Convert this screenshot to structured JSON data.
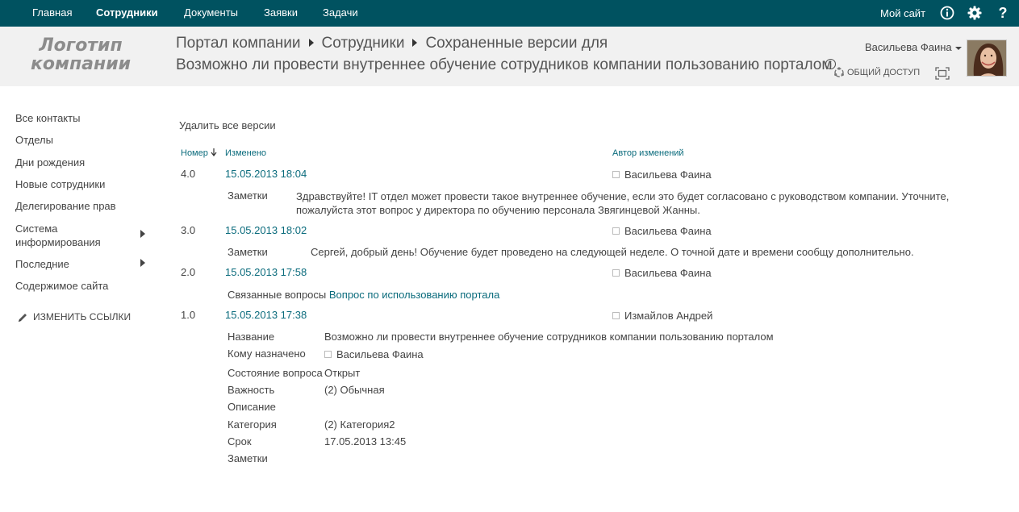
{
  "topnav": {
    "items": [
      "Главная",
      "Сотрудники",
      "Документы",
      "Заявки",
      "Задачи"
    ],
    "my_site": "Мой сайт"
  },
  "header": {
    "logo_line1": "Логотип",
    "logo_line2": "компании",
    "breadcrumb": [
      "Портал компании",
      "Сотрудники",
      "Сохраненные версии для"
    ],
    "title": "Возможно ли провести внутреннее обучение сотрудников компании пользованию порталом",
    "user_name": "Васильева Фаина",
    "share_label": "ОБЩИЙ ДОСТУП"
  },
  "leftnav": {
    "items": [
      "Все контакты",
      "Отделы",
      "Дни рождения",
      "Новые сотрудники",
      "Делегирование прав",
      "Система информирования",
      "Последние",
      "Содержимое сайта"
    ],
    "edit_links": "ИЗМЕНИТЬ ССЫЛКИ"
  },
  "content": {
    "delete_all": "Удалить все версии",
    "col_number": "Номер",
    "col_modified": "Изменено",
    "col_author": "Автор изменений",
    "versions": [
      {
        "number": "4.0",
        "date": "15.05.2013 18:04",
        "author": "Васильева Фаина",
        "notes_label": "Заметки",
        "notes": "Здравствуйте! IT отдел может провести такое внутреннее обучение, если это будет согласовано с руководством компании. Уточните, пожалуйста этот вопрос у директора по обучению персонала Звягинцевой Жанны."
      },
      {
        "number": "3.0",
        "date": "15.05.2013 18:02",
        "author": "Васильева Фаина",
        "notes_label": "Заметки",
        "notes": "Сергей, добрый день! Обучение будет проведено на следующей неделе. О точной дате и времени сообщу дополнительно."
      },
      {
        "number": "2.0",
        "date": "15.05.2013 17:58",
        "author": "Васильева Фаина",
        "related_label": "Связанные вопросы",
        "related_link": "Вопрос по использованию портала"
      },
      {
        "number": "1.0",
        "date": "15.05.2013 17:38",
        "author": "Измайлов Андрей",
        "fields": [
          {
            "label": "Название",
            "value": "Возможно ли провести внутреннее обучение сотрудников компании пользованию порталом"
          },
          {
            "label": "Кому назначено",
            "value": "Васильева Фаина"
          },
          {
            "label": "Состояние вопроса",
            "value": "Открыт"
          },
          {
            "label": "Важность",
            "value": "(2) Обычная"
          },
          {
            "label": "Описание",
            "value": ""
          },
          {
            "label": "Категория",
            "value": "(2) Категория2"
          },
          {
            "label": "Срок",
            "value": "17.05.2013 13:45"
          },
          {
            "label": "Заметки",
            "value": ""
          }
        ]
      }
    ]
  },
  "colors": {
    "topbar": "#005260",
    "header_bg": "#f1f1f1",
    "link": "#0a6b7c"
  },
  "icons": [
    "info-icon",
    "gear-icon",
    "help-icon",
    "share-icon",
    "focus-icon",
    "pencil-icon",
    "sort-down-arrow-icon",
    "chevron-right-icon",
    "presence-icon"
  ]
}
